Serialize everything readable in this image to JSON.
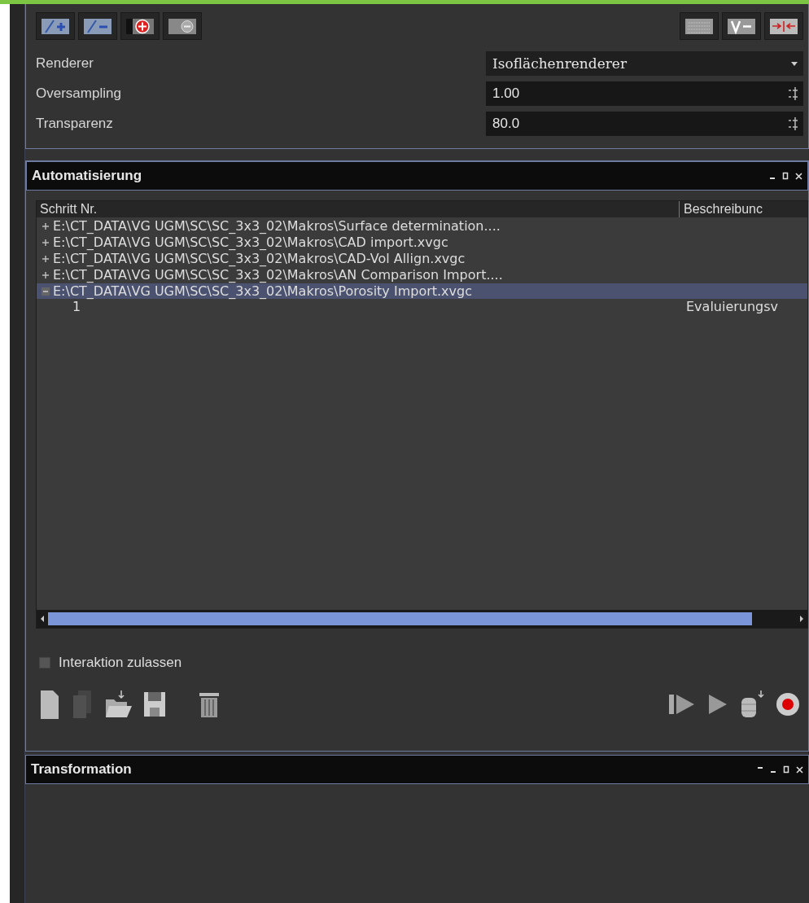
{
  "properties": {
    "rows": [
      {
        "kind": "dropdown",
        "label": "Renderer",
        "value": "Isoflächenrenderer"
      },
      {
        "kind": "spinbox",
        "label": "Oversampling",
        "value": "1.00"
      },
      {
        "kind": "spinbox",
        "label": "Transparenz",
        "value": "80.0"
      }
    ]
  },
  "automation": {
    "title": "Automatisierung",
    "table": {
      "columns": [
        "Schritt Nr.",
        "Beschreibunc"
      ],
      "rows": [
        {
          "label": "E:\\CT_DATA\\VG UGM\\SC\\SC_3x3_02\\Makros\\Surface determination....",
          "expanded": false,
          "selected": false
        },
        {
          "label": "E:\\CT_DATA\\VG UGM\\SC\\SC_3x3_02\\Makros\\CAD import.xvgc",
          "expanded": false,
          "selected": false
        },
        {
          "label": "E:\\CT_DATA\\VG UGM\\SC\\SC_3x3_02\\Makros\\CAD-Vol Allign.xvgc",
          "expanded": false,
          "selected": false
        },
        {
          "label": "E:\\CT_DATA\\VG UGM\\SC\\SC_3x3_02\\Makros\\AN Comparison Import....",
          "expanded": false,
          "selected": false
        },
        {
          "label": "E:\\CT_DATA\\VG UGM\\SC\\SC_3x3_02\\Makros\\Porosity Import.xvgc",
          "expanded": true,
          "selected": true,
          "children": [
            {
              "step": "1",
              "description": "Evaluierungsv"
            }
          ]
        }
      ]
    },
    "interaction": {
      "label": "Interaktion zulassen",
      "checked": false
    }
  },
  "transformation": {
    "title": "Transformation"
  }
}
